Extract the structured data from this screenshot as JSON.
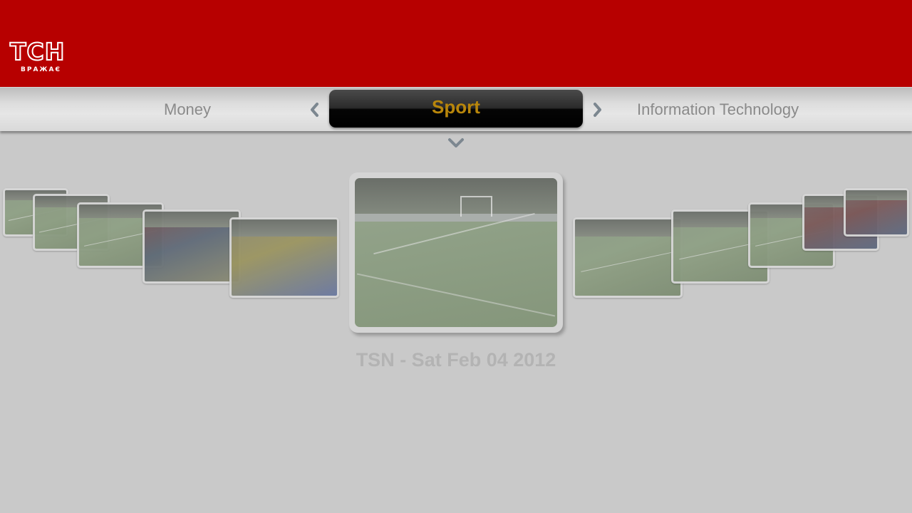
{
  "header": {
    "logo": {
      "main": "ТСН",
      "sub": "ВРАЖАЄ"
    },
    "color": "#b70000"
  },
  "categories": {
    "previous": "Money",
    "current": "Sport",
    "next": "Information Technology",
    "active_color": "#b8860b"
  },
  "icons": {
    "prev": "chevron-left-icon",
    "next": "chevron-right-icon",
    "expand": "chevron-down-icon"
  },
  "video": {
    "title": "TSN - Sat Feb 04 2012"
  }
}
